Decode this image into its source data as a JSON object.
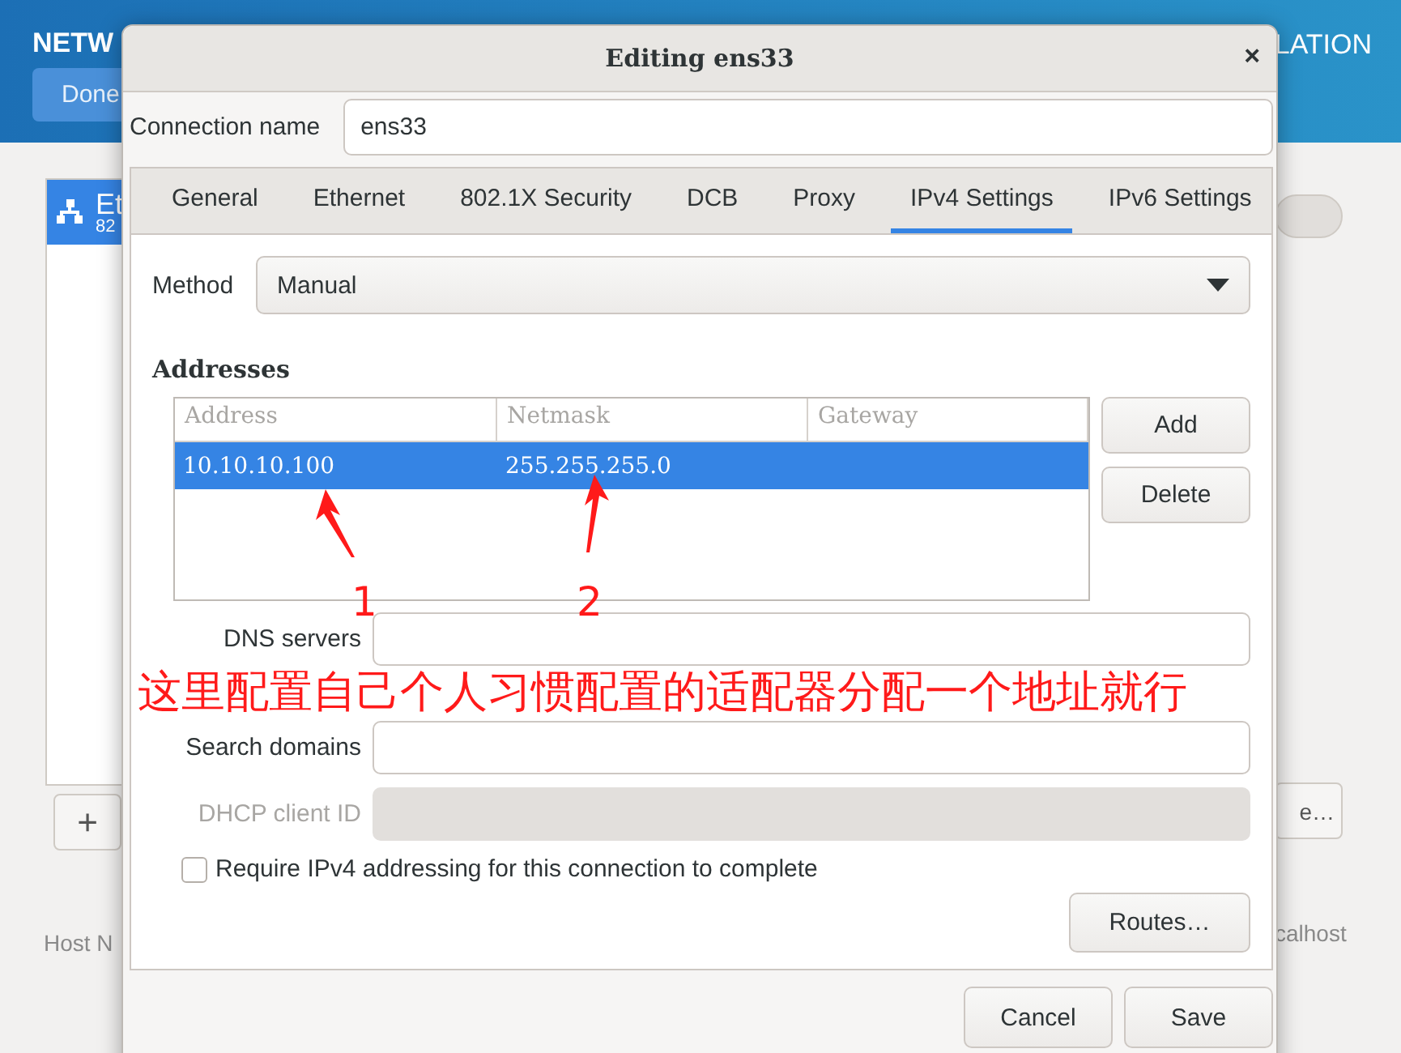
{
  "background": {
    "header_title": "NETW",
    "done_button": "Done",
    "header_right": "LATION",
    "connection_item": {
      "name": "Et",
      "detail": "82",
      "selected": true
    },
    "add_button": "+",
    "host_label": "Host N",
    "toggle": {
      "on": false
    },
    "right_button": "e…",
    "host_value": "calhost"
  },
  "dialog": {
    "title": "Editing ens33",
    "close": "×",
    "connection_name": {
      "label": "Connection name",
      "value": "ens33"
    },
    "tabs": [
      {
        "label": "General",
        "selected": false
      },
      {
        "label": "Ethernet",
        "selected": false
      },
      {
        "label": "802.1X Security",
        "selected": false
      },
      {
        "label": "DCB",
        "selected": false
      },
      {
        "label": "Proxy",
        "selected": false
      },
      {
        "label": "IPv4 Settings",
        "selected": true
      },
      {
        "label": "IPv6 Settings",
        "selected": false
      }
    ],
    "method": {
      "label": "Method",
      "value": "Manual"
    },
    "addresses": {
      "title": "Addresses",
      "columns": [
        "Address",
        "Netmask",
        "Gateway"
      ],
      "rows": [
        {
          "address": "10.10.10.100",
          "netmask": "255.255.255.0",
          "selected": true
        }
      ],
      "buttons": [
        "Add",
        "Delete"
      ]
    },
    "fields": [
      {
        "label": "DNS servers",
        "disabled": false
      },
      {
        "label": "Search domains",
        "disabled": false
      },
      {
        "label": "DHCP client ID",
        "disabled": true
      }
    ],
    "require_checkbox": {
      "label": "Require IPv4 addressing for this connection to complete",
      "checked": false
    },
    "routes_button": "Routes…",
    "footer_buttons": [
      "Cancel",
      "Save"
    ]
  },
  "annotations": {
    "numbers": [
      "1",
      "2"
    ],
    "note": "这里配置自己个人习惯配置的适配器分配一个地址就行"
  }
}
